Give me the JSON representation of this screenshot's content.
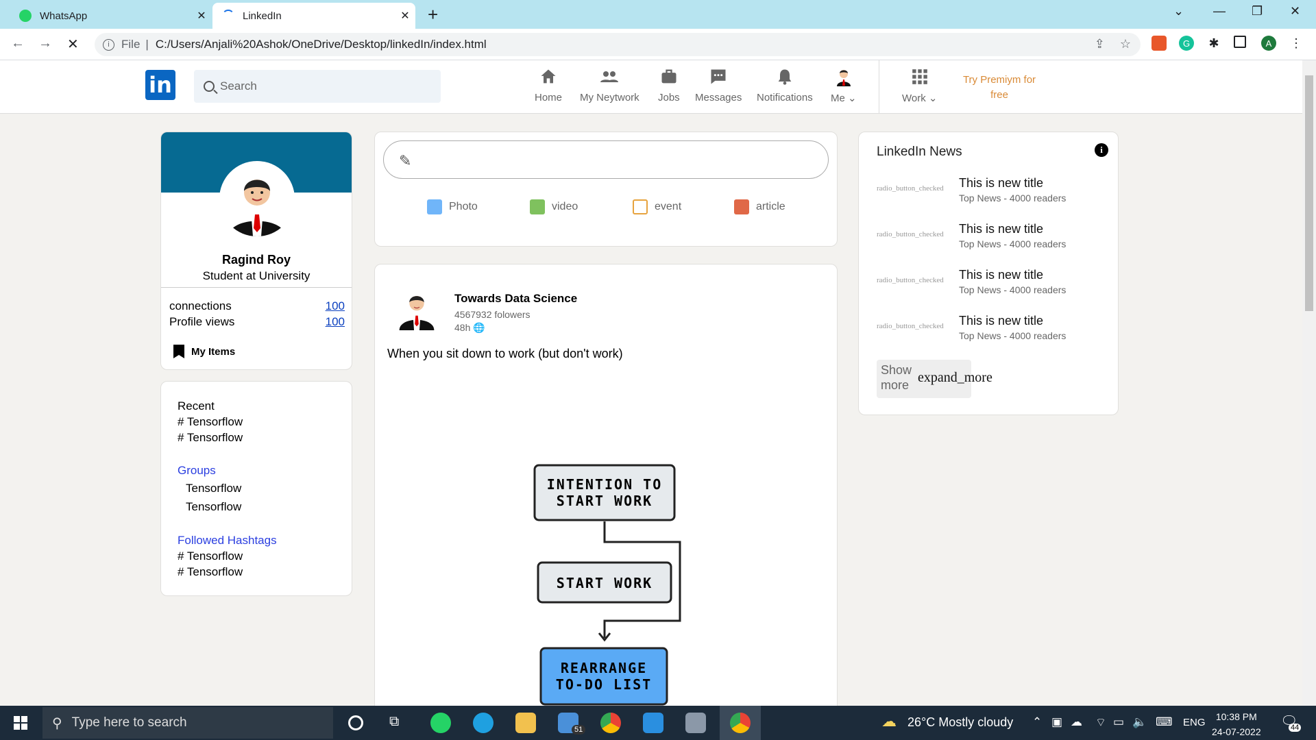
{
  "browser": {
    "tabs": [
      {
        "title": "WhatsApp",
        "active": false
      },
      {
        "title": "LinkedIn",
        "active": true
      }
    ],
    "new_tab": "+",
    "url_prefix": "File",
    "url": "C:/Users/Anjali%20Ashok/OneDrive/Desktop/linkedIn/index.html",
    "profile_initial": "A"
  },
  "header": {
    "logo": "in",
    "search_placeholder": "Search",
    "nav": [
      {
        "label": "Home",
        "icon": "home-icon"
      },
      {
        "label": "My Neytwork",
        "icon": "people-icon"
      },
      {
        "label": "Jobs",
        "icon": "briefcase-icon"
      },
      {
        "label": "Messages",
        "icon": "message-icon"
      },
      {
        "label": "Notifications",
        "icon": "bell-icon"
      },
      {
        "label": "Me",
        "icon": "avatar-icon"
      },
      {
        "label": "Work",
        "icon": "grid-icon"
      }
    ],
    "premium": "Try Premiym for free"
  },
  "profile": {
    "name": "Ragind Roy",
    "title": "Student at University",
    "connections_label": "connections",
    "connections_value": "100",
    "views_label": "Profile views",
    "views_value": "100",
    "my_items": "My Items"
  },
  "sidebar": {
    "recent_title": "Recent",
    "recent_items": [
      "# Tensorflow",
      "# Tensorflow"
    ],
    "groups_title": "Groups",
    "groups_items": [
      "Tensorflow",
      "Tensorflow"
    ],
    "hashtags_title": "Followed Hashtags",
    "hashtags_items": [
      "# Tensorflow",
      "# Tensorflow"
    ]
  },
  "share": {
    "options": [
      {
        "label": "Photo",
        "color": "#70b5f9"
      },
      {
        "label": "video",
        "color": "#7fc15e"
      },
      {
        "label": "event",
        "color": "#e7a33e"
      },
      {
        "label": "article",
        "color": "#e06847"
      }
    ]
  },
  "post": {
    "author": "Towards Data Science",
    "followers": "4567932 folowers",
    "time": "48h",
    "text": "When you sit down to work (but don't work)",
    "diagram": [
      "INTENTION TO",
      "START WORK",
      "START WORK",
      "REARRANGE",
      "TO-DO LIST"
    ]
  },
  "news": {
    "title": "LinkedIn News",
    "info_icon": "i",
    "items": [
      {
        "radio": "radio_button_checked",
        "title": "This is new title",
        "sub": "Top News - 4000 readers"
      },
      {
        "radio": "radio_button_checked",
        "title": "This is new title",
        "sub": "Top News - 4000 readers"
      },
      {
        "radio": "radio_button_checked",
        "title": "This is new title",
        "sub": "Top News - 4000 readers"
      },
      {
        "radio": "radio_button_checked",
        "title": "This is new title",
        "sub": "Top News - 4000 readers"
      }
    ],
    "show_more": "Show more",
    "expand": "expand_more"
  },
  "taskbar": {
    "search_placeholder": "Type here to search",
    "weather": "26°C  Mostly cloudy",
    "lang": "ENG",
    "time": "10:38 PM",
    "date": "24-07-2022",
    "mail_badge": "51",
    "notif_count": "44"
  },
  "colors": {
    "linkedin_blue": "#0a66c2",
    "banner": "#066a92",
    "premium": "#d98a36",
    "tab_bar": "#b7e4f0"
  }
}
